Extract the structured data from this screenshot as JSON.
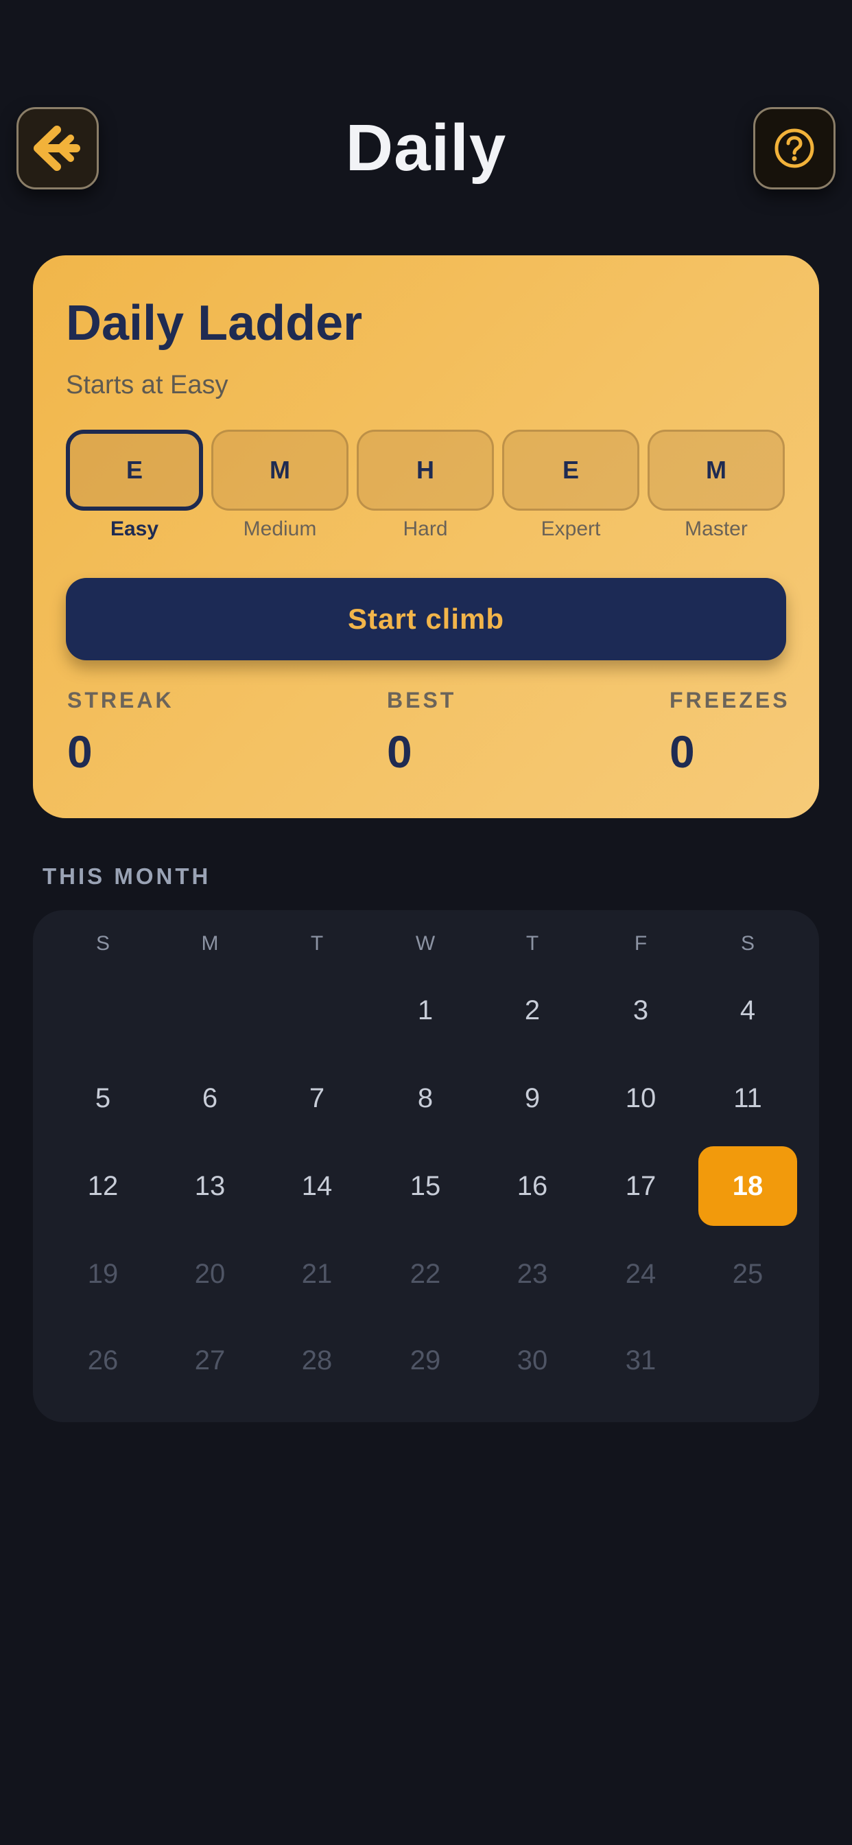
{
  "header": {
    "title": "Daily",
    "back_icon": "back-arrow-icon",
    "help_icon": "help-circle-icon"
  },
  "ladder": {
    "title": "Daily Ladder",
    "subtitle": "Starts at Easy",
    "levels": [
      {
        "letter": "E",
        "label": "Easy",
        "selected": true
      },
      {
        "letter": "M",
        "label": "Medium",
        "selected": false
      },
      {
        "letter": "H",
        "label": "Hard",
        "selected": false
      },
      {
        "letter": "E",
        "label": "Expert",
        "selected": false
      },
      {
        "letter": "M",
        "label": "Master",
        "selected": false
      }
    ],
    "start_label": "Start climb",
    "stats": [
      {
        "label": "STREAK",
        "value": "0"
      },
      {
        "label": "BEST",
        "value": "0"
      },
      {
        "label": "FREEZES",
        "value": "0"
      }
    ]
  },
  "month": {
    "section_label": "THIS MONTH",
    "weekdays": [
      "S",
      "M",
      "T",
      "W",
      "T",
      "F",
      "S"
    ],
    "first_weekday_index": 3,
    "days_in_month": 31,
    "today": 18
  },
  "colors": {
    "background": "#12141c",
    "accent": "#f29a0c",
    "card_gold": "#f1b64a",
    "navy": "#1c2a55"
  }
}
